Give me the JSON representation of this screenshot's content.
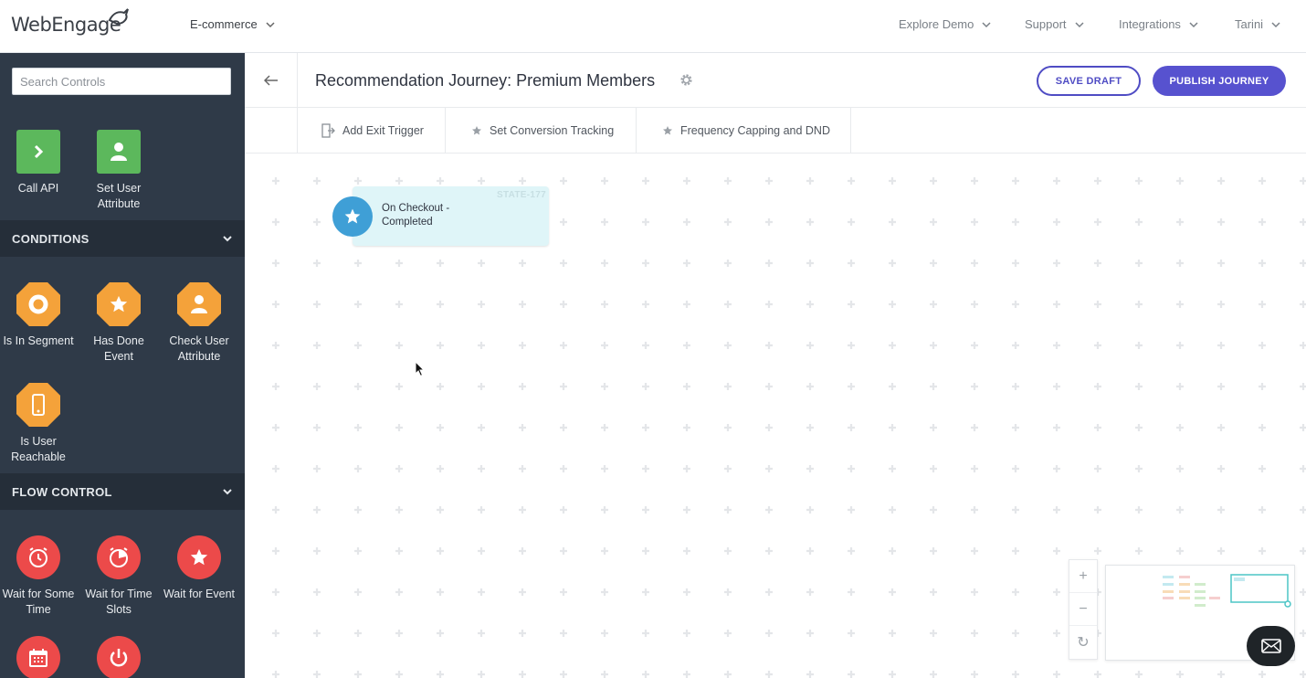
{
  "app": {
    "logo_text": "WebEngage",
    "project_selector": "E-commerce",
    "nav_right": [
      "Explore Demo",
      "Support",
      "Integrations",
      "Tarini"
    ]
  },
  "sidebar": {
    "search_placeholder": "Search Controls",
    "actions": [
      {
        "label": "Call API",
        "icon": "api-chevron-icon"
      },
      {
        "label": "Set User Attribute",
        "icon": "user-icon"
      }
    ],
    "conditions_title": "CONDITIONS",
    "conditions": [
      {
        "label": "Is In Segment",
        "icon": "segment-ring-icon"
      },
      {
        "label": "Has Done Event",
        "icon": "star-icon"
      },
      {
        "label": "Check User Attribute",
        "icon": "user-icon"
      },
      {
        "label": "Is User Reachable",
        "icon": "phone-icon"
      }
    ],
    "flow_title": "FLOW CONTROL",
    "flow": [
      {
        "label": "Wait for Some Time",
        "icon": "clock-icon"
      },
      {
        "label": "Wait for Time Slots",
        "icon": "clock-slots-icon"
      },
      {
        "label": "Wait for Event",
        "icon": "star-icon"
      },
      {
        "label": "",
        "icon": "calendar-icon"
      },
      {
        "label": "",
        "icon": "power-icon"
      }
    ],
    "colors": {
      "action": "#5cb85c",
      "condition": "#f4a23a",
      "flow": "#ec4a4a"
    }
  },
  "journey": {
    "title": "Recommendation Journey: Premium Members",
    "save_draft": "SAVE DRAFT",
    "publish": "PUBLISH JOURNEY",
    "toolbar": [
      "Add Exit Trigger",
      "Set Conversion Tracking",
      "Frequency Capping and DND"
    ]
  },
  "canvas": {
    "node": {
      "id": "STATE-177",
      "text": "On Checkout - Completed",
      "icon": "star-icon"
    },
    "zoom_controls": [
      "+",
      "−",
      "↻"
    ]
  }
}
